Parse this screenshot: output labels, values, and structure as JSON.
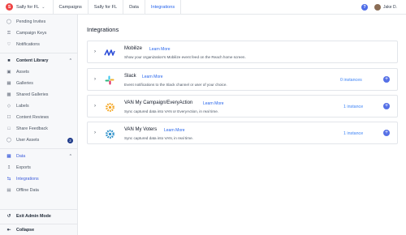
{
  "topbar": {
    "org_name": "Sally for FL",
    "nav": [
      "Campaigns",
      "Sally for FL",
      "Data",
      "Integrations"
    ],
    "user_name": "Jake D."
  },
  "sidebar": {
    "top_items": [
      {
        "label": "Pending Invites",
        "icon": "user-clock-icon"
      },
      {
        "label": "Campaign Keys",
        "icon": "key-icon"
      },
      {
        "label": "Notifications",
        "icon": "bell-icon"
      }
    ],
    "content_library": {
      "label": "Content Library",
      "items": [
        {
          "label": "Assets",
          "icon": "image-icon"
        },
        {
          "label": "Galleries",
          "icon": "gallery-icon"
        },
        {
          "label": "Shared Galleries",
          "icon": "shared-gallery-icon"
        },
        {
          "label": "Labels",
          "icon": "tag-icon"
        },
        {
          "label": "Content Reviews",
          "icon": "review-icon"
        },
        {
          "label": "Share Feedback",
          "icon": "comment-icon"
        },
        {
          "label": "User Assets",
          "icon": "user-assets-icon",
          "badge": "2"
        }
      ]
    },
    "data_section": {
      "label": "Data",
      "items": [
        {
          "label": "Exports",
          "icon": "export-icon"
        },
        {
          "label": "Integrations",
          "icon": "integrations-icon",
          "active": true
        },
        {
          "label": "Offline Data",
          "icon": "offline-data-icon"
        }
      ]
    },
    "exit_label": "Exit Admin Mode",
    "collapse_label": "Collapse"
  },
  "main": {
    "title": "Integrations",
    "integrations": [
      {
        "name": "Mobilize",
        "learn": "Learn More",
        "desc": "Show your organization's Mobilize event feed on the Reach home screen.",
        "instances": ""
      },
      {
        "name": "Slack",
        "learn": "Learn More",
        "desc": "Event notifications to the Slack channel or user of your choice.",
        "instances": "0 instances"
      },
      {
        "name": "VAN My Campaign/EveryAction",
        "learn": "Learn More",
        "desc": "Sync captured data into VAN or EveryAction, in real time.",
        "instances": "1 instance"
      },
      {
        "name": "VAN My Voters",
        "learn": "Learn More",
        "desc": "Sync captured data into VAN, in real time.",
        "instances": "1 instance"
      }
    ]
  },
  "colors": {
    "accent": "#3b5bdb",
    "link": "#2563eb",
    "add_button": "#5570e6",
    "van_orange": "#f5a623",
    "van_blue": "#2a8fc9"
  }
}
